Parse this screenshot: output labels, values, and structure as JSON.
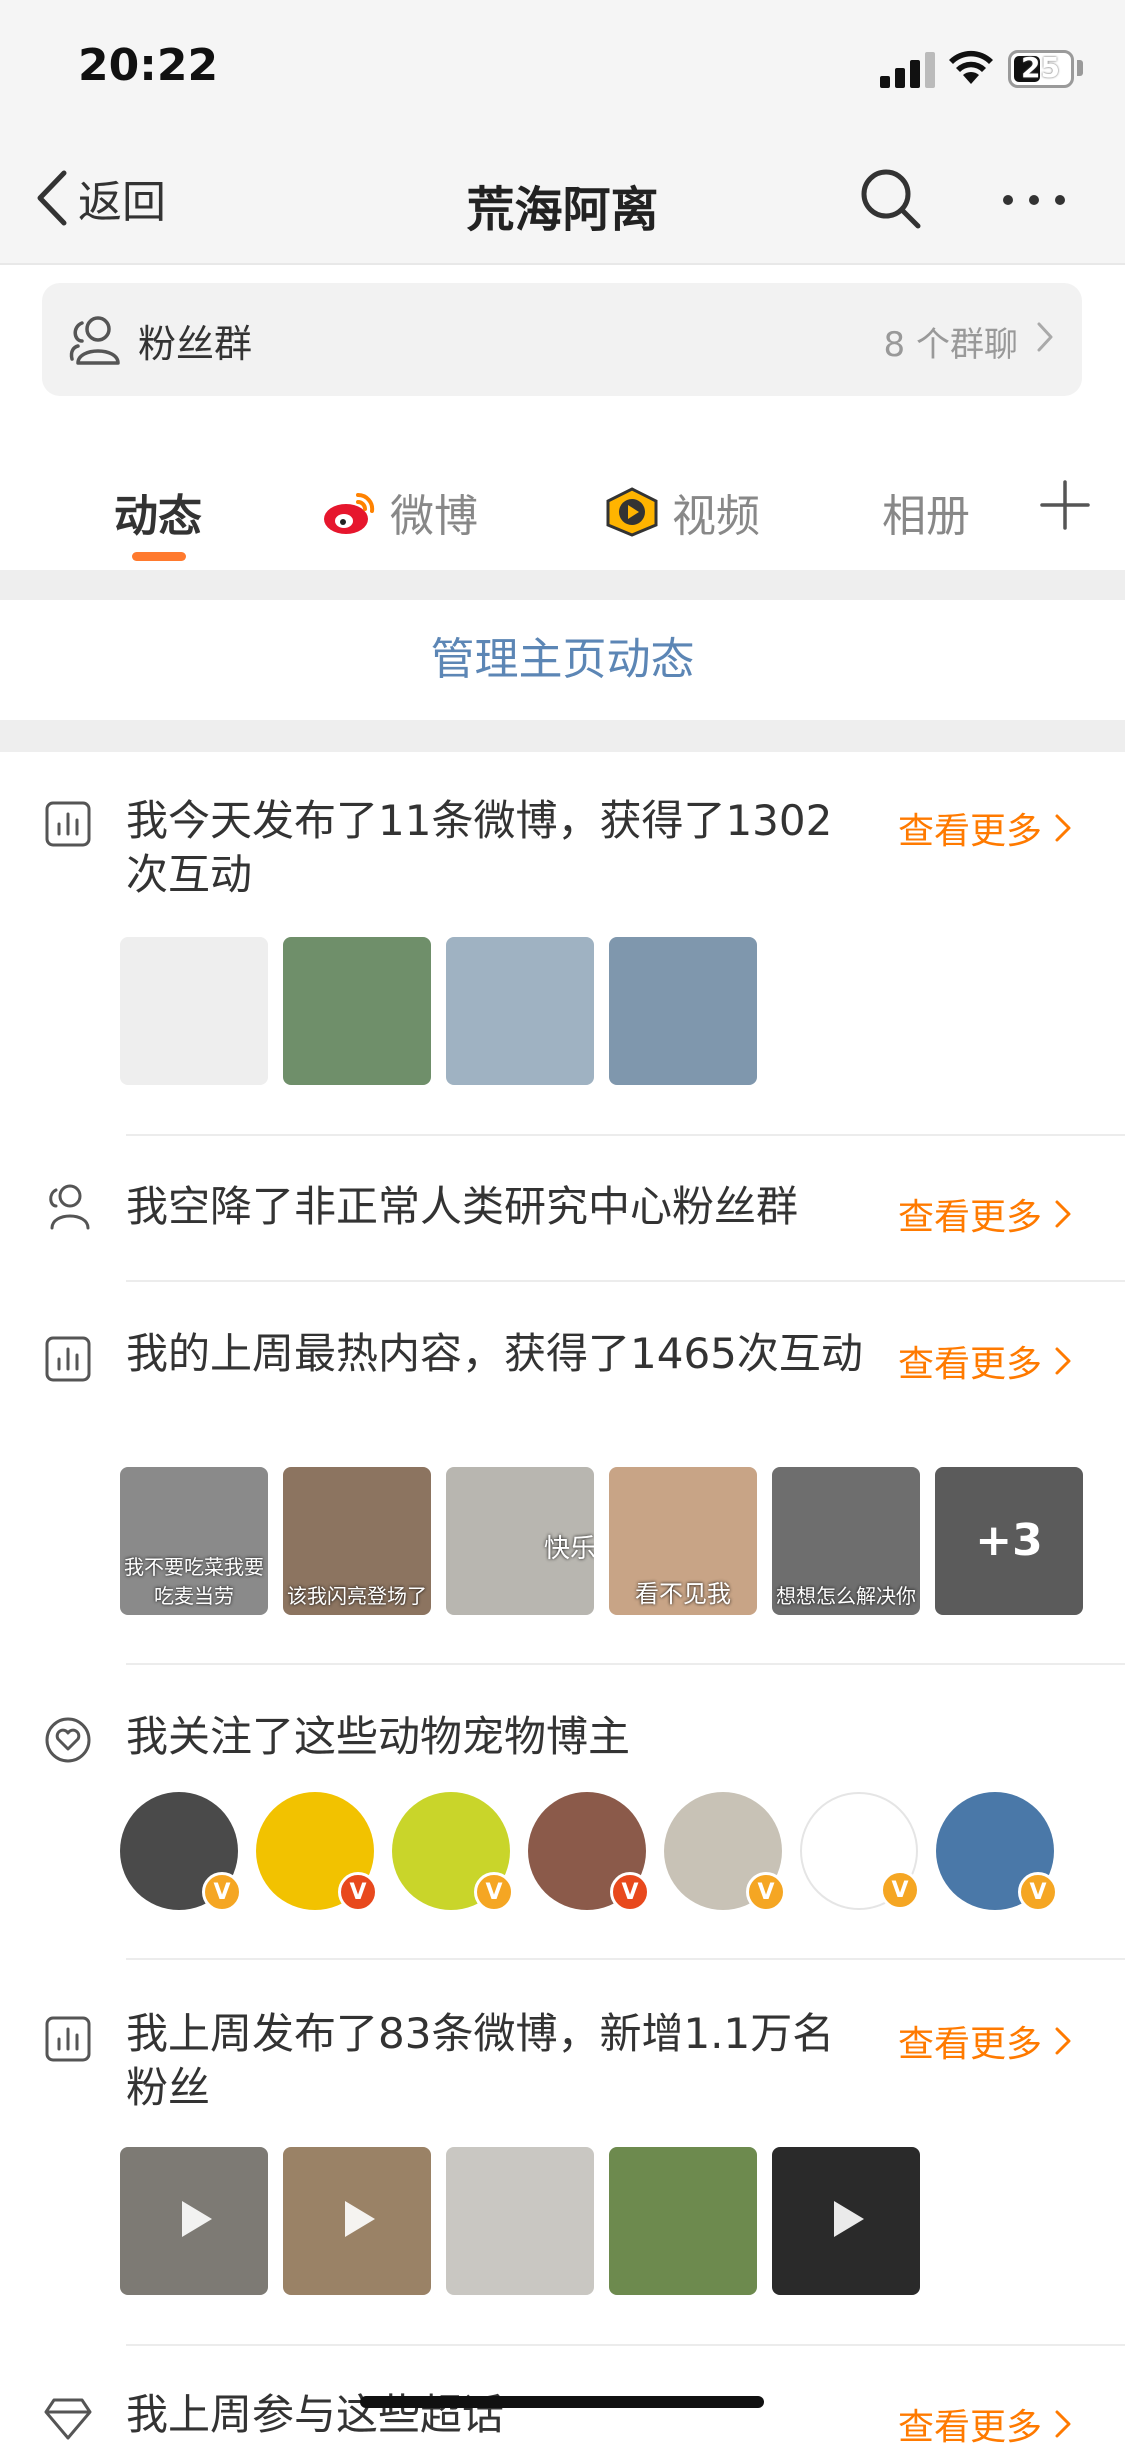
{
  "status": {
    "time": "20:22",
    "battery": "25"
  },
  "nav": {
    "back_label": "返回",
    "title": "荒海阿离"
  },
  "fans": {
    "label": "粉丝群",
    "count": "8 个群聊"
  },
  "tabs": [
    {
      "label": "动态",
      "active": true
    },
    {
      "label": "微博",
      "icon": "weibo-logo-icon"
    },
    {
      "label": "视频",
      "icon": "video-play-icon"
    },
    {
      "label": "相册"
    }
  ],
  "manage_label": "管理主页动态",
  "more_label": "查看更多",
  "items": [
    {
      "text": "我今天发布了11条微博，获得了1302次互动",
      "icon": "stats-icon",
      "thumbs": [
        {
          "color": "#eeeeee",
          "caption": ""
        },
        {
          "color": "#6f8f6a",
          "caption": ""
        },
        {
          "color": "#9fb2c2",
          "caption": ""
        },
        {
          "color": "#7f97ad",
          "caption": ""
        }
      ]
    },
    {
      "text": "我空降了非正常人类研究中心粉丝群",
      "icon": "group-icon"
    },
    {
      "text": "我的上周最热内容，获得了1465次互动",
      "icon": "stats-icon",
      "thumbs": [
        {
          "color": "#8a8a8a",
          "caption": "我不要吃菜我要吃麦当劳"
        },
        {
          "color": "#8c7460",
          "caption": "该我闪亮登场了"
        },
        {
          "color": "#b8b6b0",
          "caption": "快乐"
        },
        {
          "color": "#c8a486",
          "caption": "看不见我"
        },
        {
          "color": "#6e6e6e",
          "caption": "想想怎么解决你"
        },
        {
          "color": "#5b5b5b",
          "caption": "+3"
        }
      ]
    },
    {
      "text": "我关注了这些动物宠物博主",
      "icon": "heart-icon"
    },
    {
      "text": "我上周发布了83条微博，新增1.1万名粉丝",
      "icon": "stats-icon",
      "thumbs": [
        {
          "color": "#7d7a74",
          "caption": ""
        },
        {
          "color": "#9a8266",
          "caption": ""
        },
        {
          "color": "#c9c7c2",
          "caption": ""
        },
        {
          "color": "#6d8a4e",
          "caption": ""
        },
        {
          "color": "#2a2a2a",
          "caption": ""
        }
      ]
    },
    {
      "text": "我上周参与这些超话",
      "icon": "diamond-icon"
    }
  ],
  "avatars": [
    {
      "color": "#4a4a4a",
      "badge": "V",
      "badge_color": "#f5a623"
    },
    {
      "color": "#f2c200",
      "badge": "V",
      "badge_color": "#e8491d"
    },
    {
      "color": "#c9d52a",
      "badge": "V",
      "badge_color": "#f5a623"
    },
    {
      "color": "#8b5a4a",
      "badge": "V",
      "badge_color": "#e8491d"
    },
    {
      "color": "#c8c2b6",
      "badge": "V",
      "badge_color": "#f5a623"
    },
    {
      "color": "#ffffff",
      "badge": "V",
      "badge_color": "#f5a623"
    },
    {
      "color": "#4a78a8",
      "badge": "V",
      "badge_color": "#f5a623"
    }
  ],
  "colors": {
    "accent": "#ff7a00",
    "link_blue": "#5c86b5",
    "tab_underline": "#ff7a2e"
  }
}
